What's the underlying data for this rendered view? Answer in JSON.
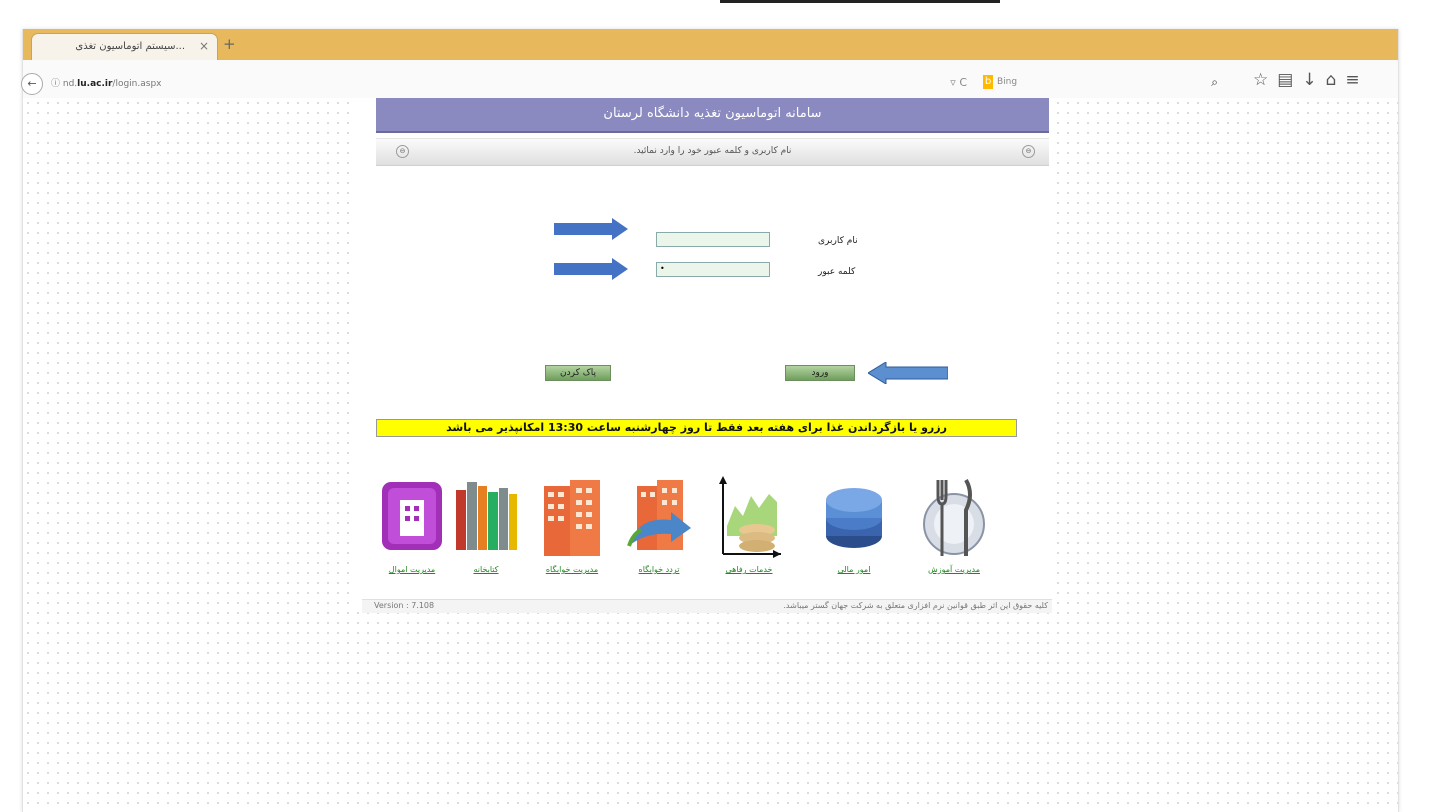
{
  "browser": {
    "tab_title": "...سیستم اتوماسیون تغذی",
    "tab_close": "×",
    "new_tab": "+",
    "url_host": "nd.",
    "url_bold": "lu.ac.ir",
    "url_path": "/login.aspx",
    "url_tools": "▿ C",
    "search_placeholder": "Bing",
    "search_engine": "Bing"
  },
  "page": {
    "header_title": "سامانه اتوماسیون تغذیه دانشگاه لرستان",
    "instruction": "نام کاربری و کلمه عبور خود را وارد نمائید.",
    "username_label": "نام کاربری",
    "password_label": "کلمه عبور",
    "username_value": "",
    "password_value": "•",
    "login_button": "ورود",
    "clear_button": "پاک کردن",
    "notice": "رزرو یا بازگرداندن غذا برای هفته بعد فقط تا روز چهارشنبه ساعت 13:30 امکانپذیر می باشد",
    "version": "Version : 7.108",
    "copyright": "کلیه حقوق این اثر طبق قوانین نرم افزاری متعلق به شرکت جهان گستر میباشد."
  },
  "modules": [
    {
      "label": "مدیریت اموال",
      "icon": "property-icon"
    },
    {
      "label": "کتابخانه",
      "icon": "library-icon"
    },
    {
      "label": "مدیریت خوابگاه",
      "icon": "dormitory-icon"
    },
    {
      "label": "تردد خوابگاه",
      "icon": "dorm-traffic-icon"
    },
    {
      "label": "خدمات رفاهی",
      "icon": "welfare-icon"
    },
    {
      "label": "امور مالی",
      "icon": "finance-icon"
    },
    {
      "label": "مدیریت آموزش",
      "icon": "education-icon"
    }
  ],
  "colors": {
    "header_bg": "#8b8ac0",
    "notice_bg": "#ffff00",
    "arrow": "#4472c4",
    "tabbar": "#e8b95c"
  }
}
